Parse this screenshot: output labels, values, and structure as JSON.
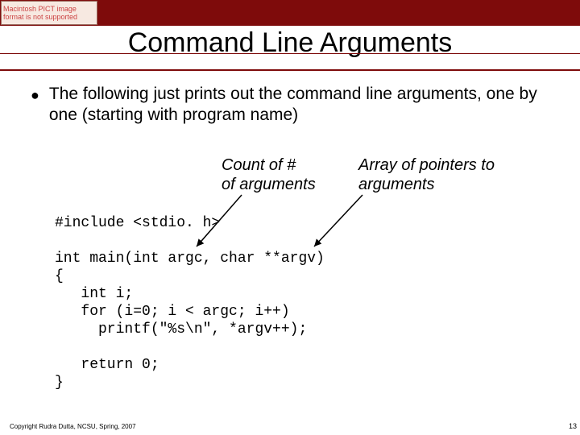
{
  "pict_placeholder": "Macintosh PICT image format is not supported",
  "title": "Command Line Arguments",
  "bullet_text": "The following just prints out the command line arguments, one by one (starting with program name)",
  "annotation_argc_l1": "Count of #",
  "annotation_argc_l2": "of arguments",
  "annotation_argv_l1": "Array of pointers to",
  "annotation_argv_l2": "arguments",
  "code": "#include <stdio. h>\n\nint main(int argc, char **argv)\n{\n   int i;\n   for (i=0; i < argc; i++)\n     printf(\"%s\\n\", *argv++);\n\n   return 0;\n}",
  "copyright": "Copyright Rudra Dutta, NCSU, Spring, 2007",
  "page_number": "13"
}
